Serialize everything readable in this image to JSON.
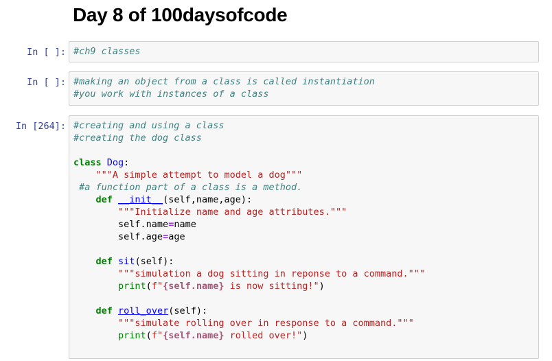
{
  "title": "Day 8 of 100daysofcode",
  "cells": [
    {
      "prompt": "In [ ]:",
      "lines": [
        "#ch9 classes"
      ]
    },
    {
      "prompt": "In [ ]:",
      "lines": [
        "#making an object from a class is called instantiation",
        "#you work with instances of a class"
      ]
    },
    {
      "prompt": "In [264]:",
      "comments": [
        "#creating and using a class",
        "#creating the dog class"
      ],
      "code": {
        "kw_class": "class",
        "class_name": "Dog",
        "colon": ":",
        "class_doc": "\"\"\"A simple attempt to model a dog\"\"\"",
        "method_comment": "#a function part of a class is a method.",
        "kw_def": "def",
        "init_name": "__init__",
        "init_params": "(self,name,age):",
        "init_doc": "\"\"\"Initialize name and age attributes.\"\"\"",
        "self_name": "self.name",
        "eq": "=",
        "name_var": "name",
        "self_age": "self.age",
        "age_var": "age",
        "sit_name": "sit",
        "sit_params": "(self):",
        "sit_doc": "\"\"\"simulation a dog sitting in reponse to a command.\"\"\"",
        "print_fn": "print",
        "open_paren": "(",
        "fstr_prefix": "f\"",
        "fmt_self_name": "{self.name}",
        "sit_msg": " is now sitting!\"",
        "close_paren": ")",
        "roll_name": "roll_over",
        "roll_params": "(self):",
        "roll_doc": "\"\"\"simulate rolling over in response to a command.\"\"\"",
        "roll_msg": " rolled over!\""
      }
    }
  ]
}
